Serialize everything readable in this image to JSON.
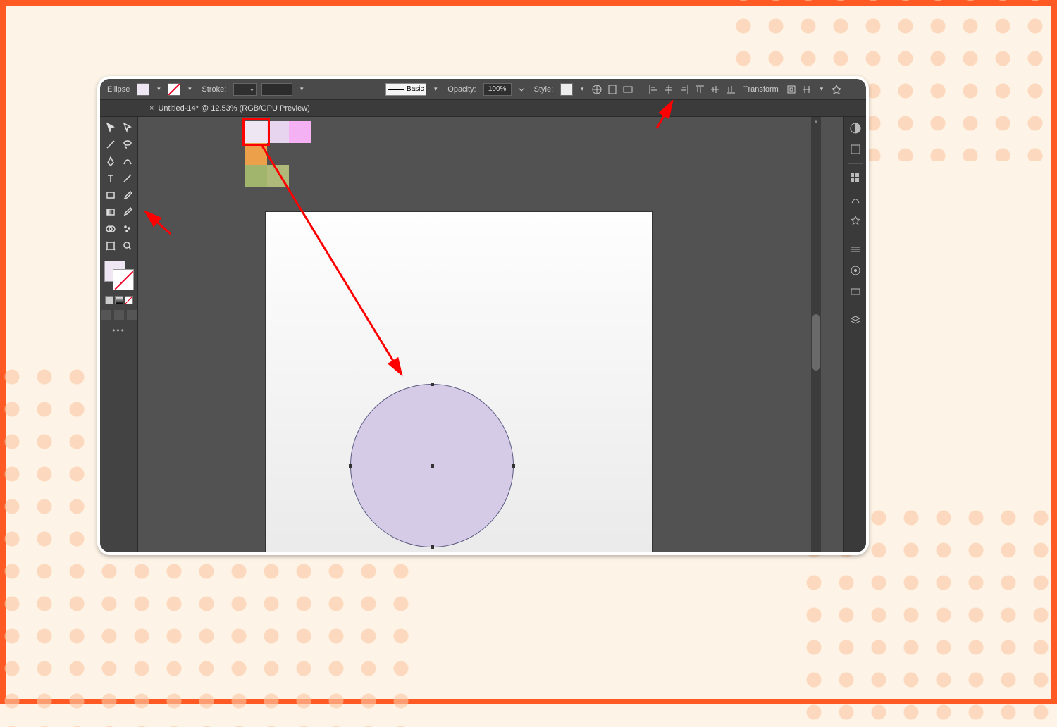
{
  "topbar": {
    "selection_label": "Ellipse",
    "stroke_label": "Stroke:",
    "brush_label": "Basic",
    "opacity_label": "Opacity:",
    "opacity_value": "100%",
    "style_label": "Style:",
    "transform_label": "Transform"
  },
  "tab": {
    "title": "Untitled-14* @ 12.53% (RGB/GPU Preview)"
  },
  "swatches": {
    "row1": [
      "#eee7f3",
      "#e7d4ef",
      "#f4b1f4"
    ],
    "row2": [
      "#eca04a"
    ],
    "row3": [
      "#a1b56d",
      "#aeb97a"
    ],
    "highlighted_index": 0
  },
  "canvas": {
    "shape": "ellipse",
    "fill": "#d6cbe6",
    "stroke": "#5a5a82"
  },
  "tools": {
    "left_column": [
      "selection",
      "direct-selection",
      "magic-wand",
      "lasso",
      "pen",
      "curvature",
      "type",
      "line-segment",
      "rectangle",
      "paintbrush",
      "shape-builder",
      "gradient",
      "eyedropper",
      "artboard",
      "zoom"
    ],
    "right_panels": [
      "color",
      "swatches",
      "brushes",
      "symbols",
      "stroke",
      "appearance",
      "graphic-styles",
      "layers"
    ]
  },
  "icons": {
    "globe": "globe-icon",
    "doc": "document-setup-icon",
    "prefs": "preferences-icon",
    "align_h_left": "align-left-icon",
    "align_h_center": "align-hcenter-icon",
    "align_h_right": "align-right-icon",
    "align_v_top": "align-top-icon",
    "align_v_middle": "align-vmiddle-icon",
    "align_v_bottom": "align-bottom-icon",
    "isolate": "isolate-icon",
    "arrange": "arrange-icon",
    "pin": "pin-icon"
  }
}
